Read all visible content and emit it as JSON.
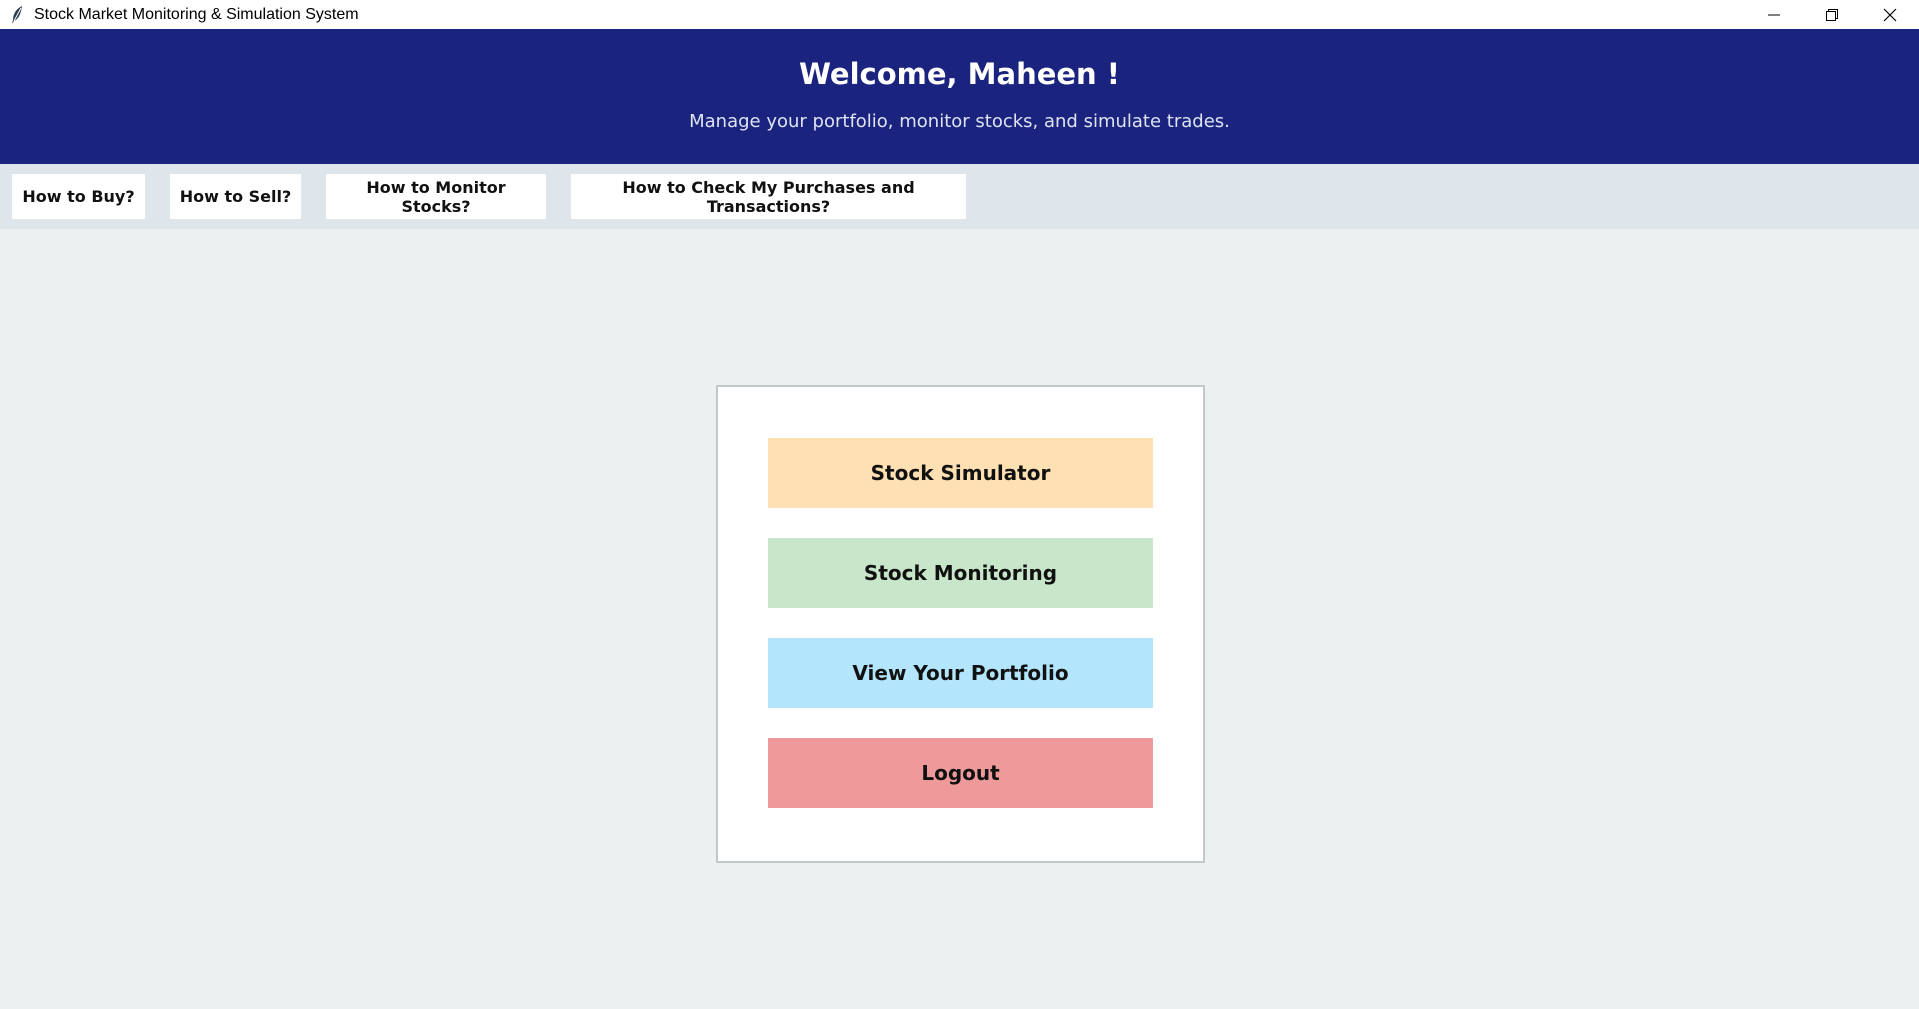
{
  "window": {
    "title": "Stock Market Monitoring & Simulation System",
    "icon": "feather-icon",
    "controls": [
      "minimize-icon",
      "restore-icon",
      "close-icon"
    ]
  },
  "header": {
    "welcome": "Welcome, Maheen !",
    "subtitle": "Manage your portfolio, monitor stocks, and simulate trades.",
    "background": "#1a237e"
  },
  "help_bar": {
    "buttons": [
      {
        "label": "How to Buy?"
      },
      {
        "label": "How to Sell?"
      },
      {
        "label": "How to Monitor Stocks?"
      },
      {
        "label": "How to Check My Purchases and Transactions?"
      }
    ]
  },
  "menu": {
    "buttons": [
      {
        "label": "Stock Simulator",
        "color": "#ffe0b2"
      },
      {
        "label": "Stock Monitoring",
        "color": "#c8e6c9"
      },
      {
        "label": "View Your Portfolio",
        "color": "#b3e5fc"
      },
      {
        "label": "Logout",
        "color": "#ef9a9a"
      }
    ]
  }
}
